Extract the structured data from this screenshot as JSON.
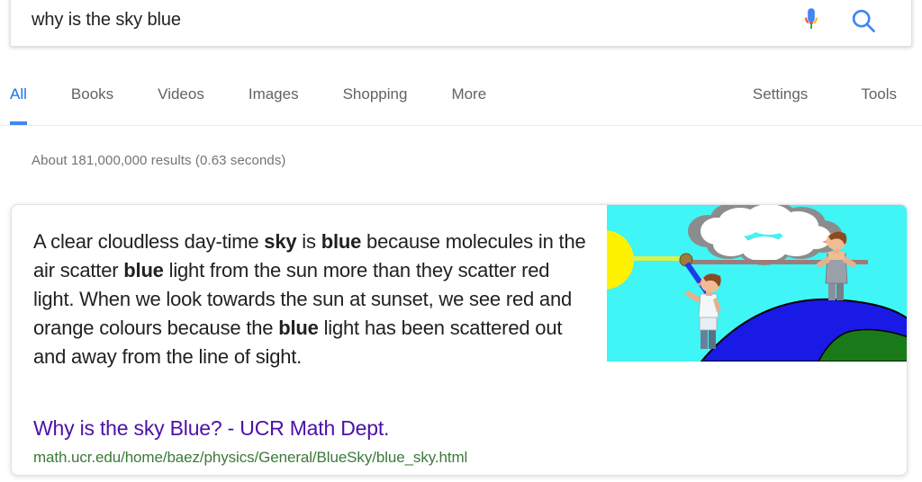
{
  "search": {
    "query": "why is the sky blue",
    "placeholder": "Search",
    "mic_icon": "microphone-icon",
    "search_icon": "search-icon"
  },
  "tabs": {
    "left": [
      {
        "label": "All",
        "active": true
      },
      {
        "label": "Books",
        "active": false
      },
      {
        "label": "Videos",
        "active": false
      },
      {
        "label": "Images",
        "active": false
      },
      {
        "label": "Shopping",
        "active": false
      },
      {
        "label": "More",
        "active": false
      }
    ],
    "right": [
      {
        "label": "Settings"
      },
      {
        "label": "Tools"
      }
    ]
  },
  "result_stats": "About 181,000,000 results (0.63 seconds)",
  "featured_snippet": {
    "text_parts": [
      {
        "text": "A clear cloudless day-time ",
        "bold": false
      },
      {
        "text": "sky",
        "bold": true
      },
      {
        "text": " is ",
        "bold": false
      },
      {
        "text": "blue",
        "bold": true
      },
      {
        "text": " because molecules in the air scatter ",
        "bold": false
      },
      {
        "text": "blue",
        "bold": true
      },
      {
        "text": " light from the sun more than they scatter red light. When we look towards the sun at sunset, we see red and orange colours because the ",
        "bold": false
      },
      {
        "text": "blue",
        "bold": true
      },
      {
        "text": " light has been scattered out and away from the line of sight.",
        "bold": false
      }
    ],
    "full_text": "A clear cloudless day-time sky is blue because molecules in the air scatter blue light from the sun more than they scatter red light. When we look towards the sun at sunset, we see red and orange colours because the blue light has been scattered out and away from the line of sight.",
    "result_title": "Why is the sky Blue? - UCR Math Dept.",
    "result_url": "math.ucr.edu/home/baez/physics/General/BlueSky/blue_sky.html",
    "thumbnail_alt": "sky-scattering-diagram"
  },
  "colors": {
    "accent_blue": "#4285f4",
    "tab_active": "#1a73e8",
    "link_visited": "#4b11a8",
    "url_green": "#3c7a38",
    "text_gray": "#70757a",
    "sky_cyan": "#3ff5f5",
    "sun_yellow": "#fff200",
    "earth_blue": "#1a1ae6",
    "land_green": "#1a7a1a",
    "ray_brown": "#9e7b7b",
    "ray_blue": "#1a3ce6",
    "cloud_gray": "#8c8c8c"
  }
}
